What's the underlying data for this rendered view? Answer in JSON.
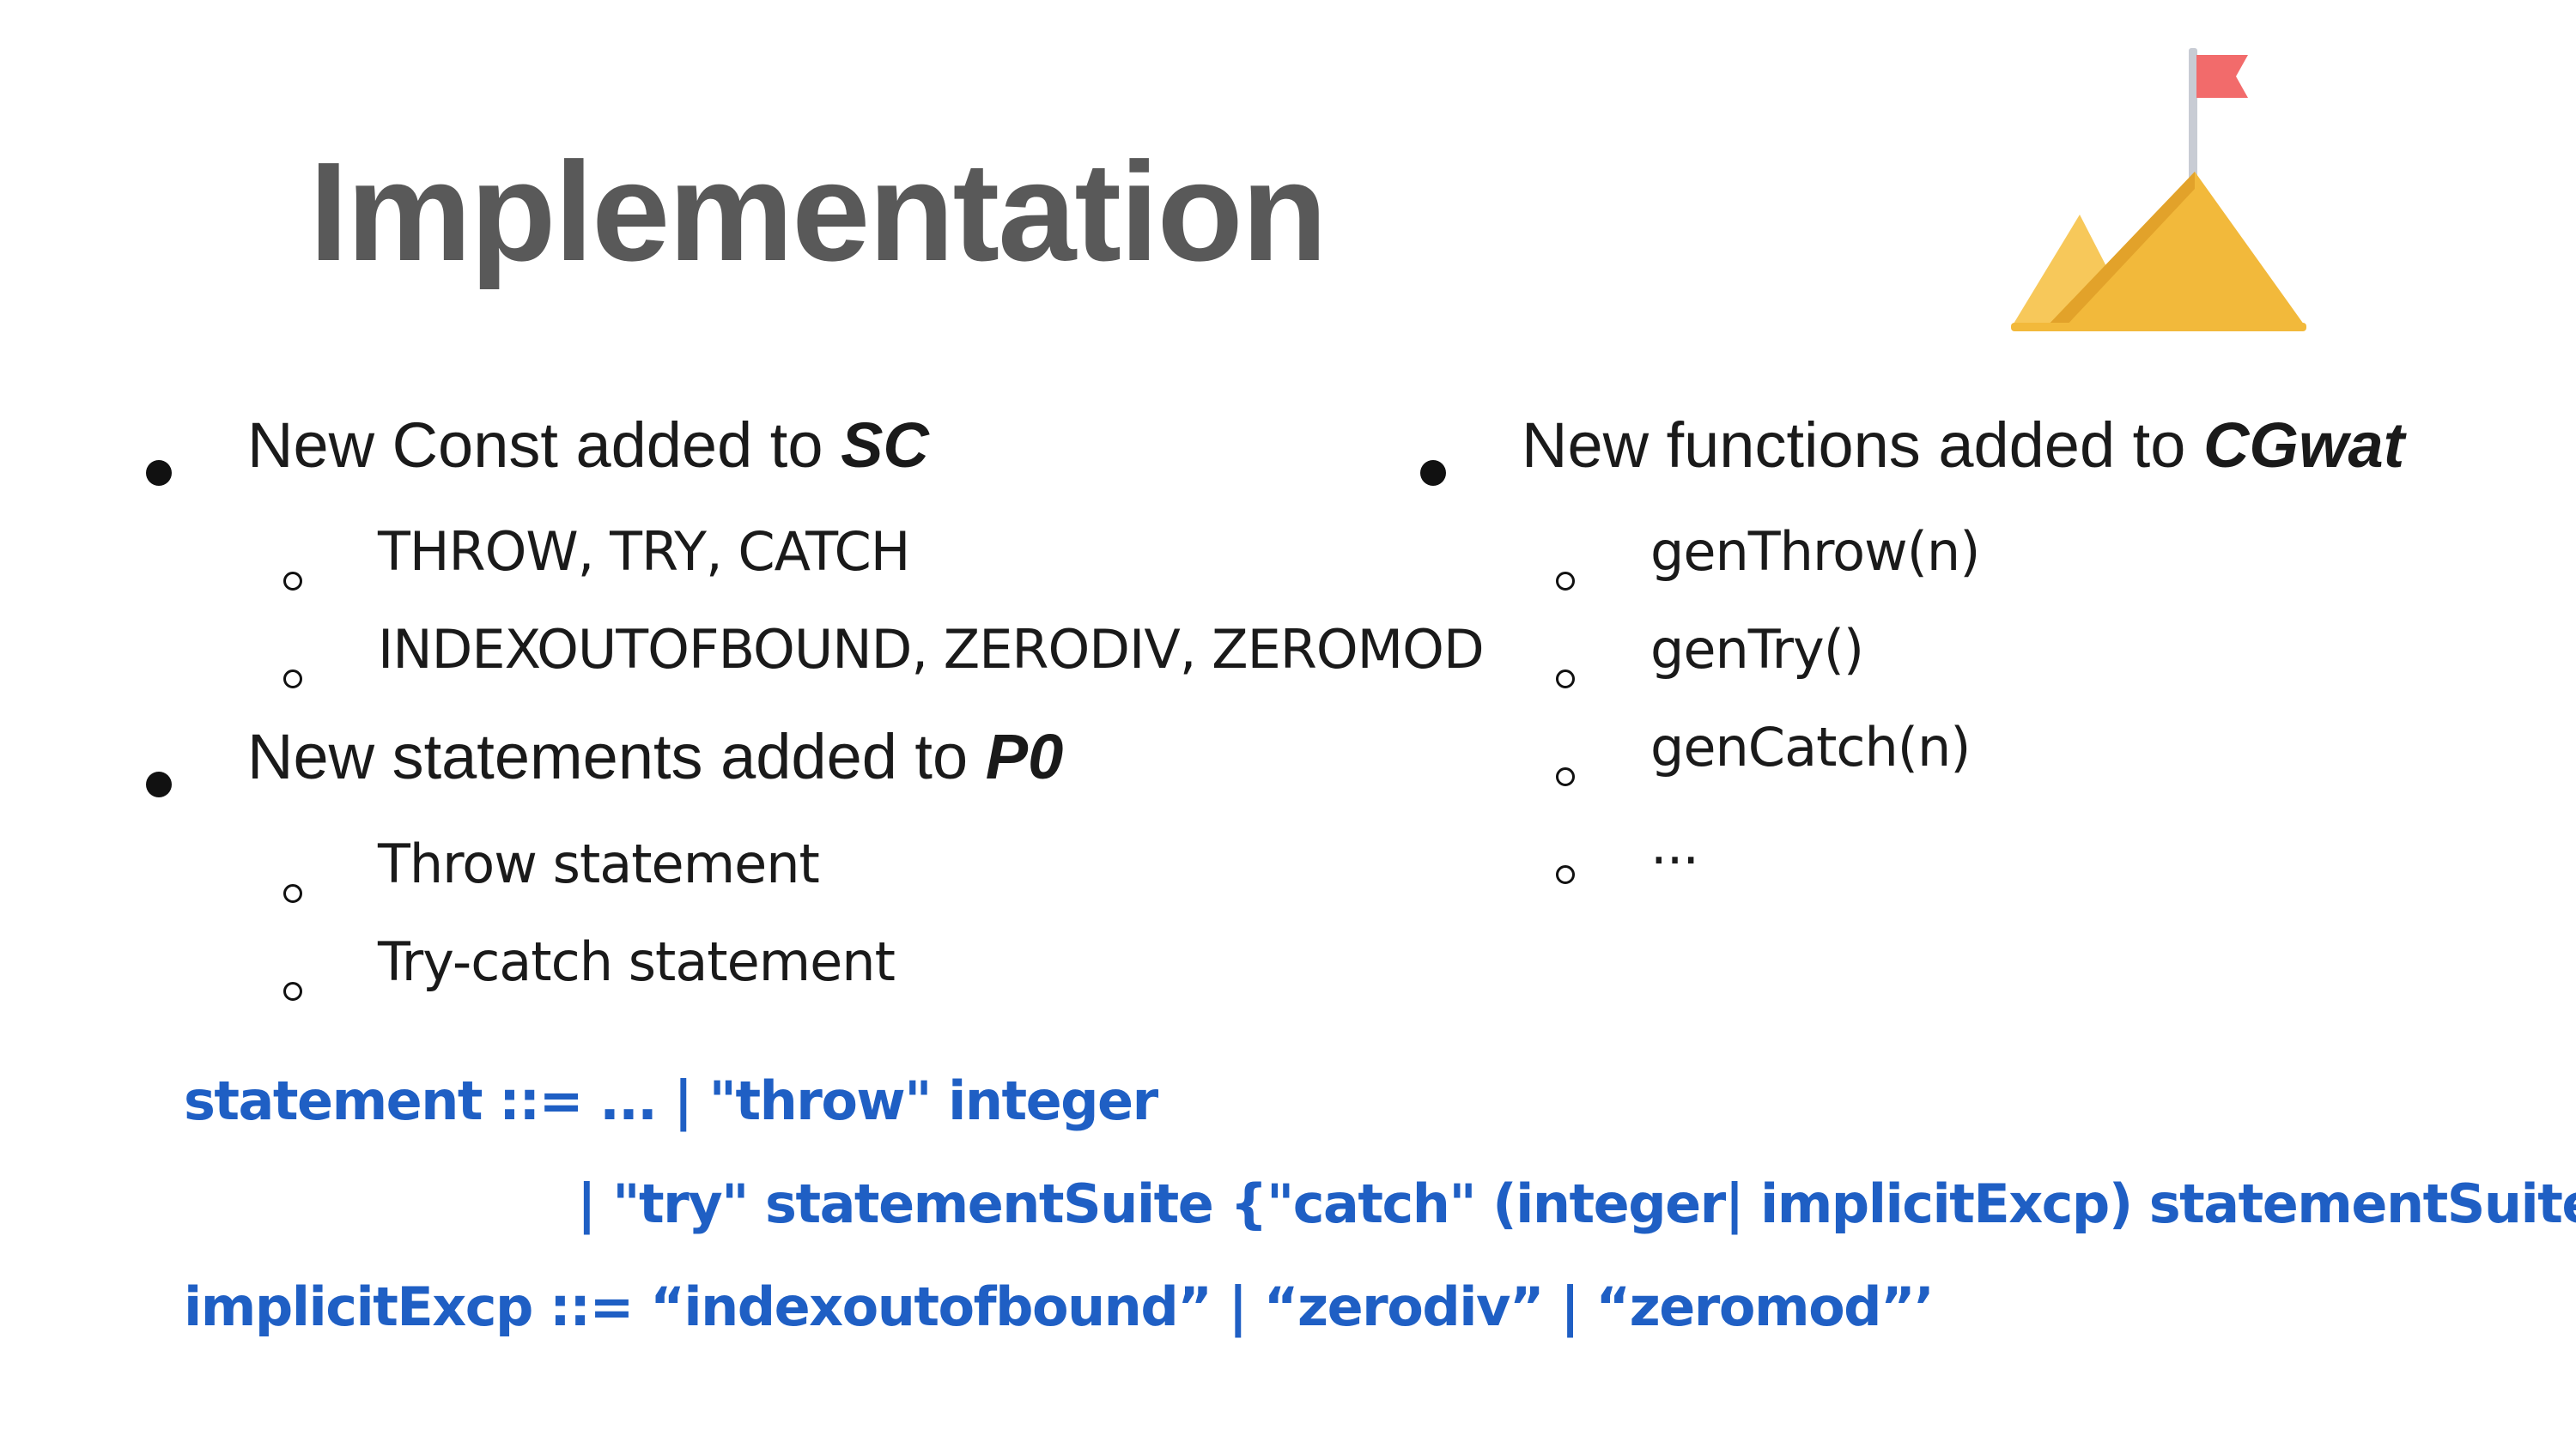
{
  "title": "Implementation",
  "left_column": {
    "bullet1": {
      "prefix": "New Const added to ",
      "emph": "SC",
      "items": [
        "THROW, TRY, CATCH",
        "INDEXOUTOFBOUND, ZERODIV, ZEROMOD"
      ]
    },
    "bullet2": {
      "prefix": "New statements added to ",
      "emph": "P0",
      "items": [
        "Throw statement",
        "Try-catch statement"
      ]
    }
  },
  "right_column": {
    "bullet1": {
      "prefix": "New functions added to ",
      "emph": "CGwat",
      "items": [
        "genThrow(n)",
        "genTry()",
        "genCatch(n)",
        "..."
      ]
    }
  },
  "grammar": {
    "line1": "statement ::= ... | \"throw\" integer",
    "line2": "| \"try\" statementSuite  {\"catch\" (integer| implicitExcp) statementSuite}",
    "line3": "implicitExcp ::= “indexoutofbound” | “zerodiv” | “zeromod”’"
  },
  "icon": {
    "name": "mountain-flag-icon",
    "flag_color": "#f26b6b",
    "pole_color": "#c8ccd4",
    "mountain_color": "#f2b93b",
    "mountain_light": "#f7c85a",
    "mountain_shadow": "#e2a22a"
  },
  "colors": {
    "title": "#595959",
    "body_text": "#1a1a1a",
    "grammar_text": "#1f5fc4"
  }
}
